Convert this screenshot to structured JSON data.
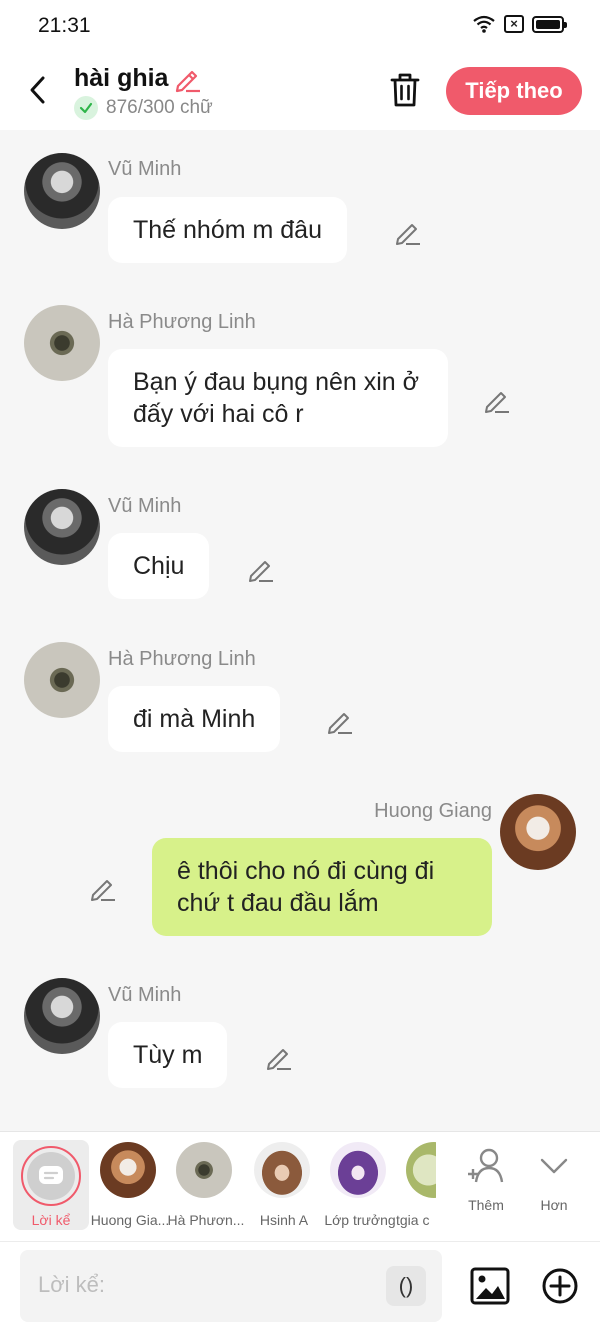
{
  "status_bar": {
    "time": "21:31"
  },
  "header": {
    "title": "hài ghia",
    "word_count": "876/300 chữ",
    "next_button": "Tiếp theo"
  },
  "messages": [
    {
      "sender": "Vũ Minh",
      "text": "Thế nhóm m đâu",
      "side": "left"
    },
    {
      "sender": "Hà Phương Linh",
      "text": "Bạn ý đau bụng nên xin ở đấy với hai cô r",
      "side": "left"
    },
    {
      "sender": "Vũ Minh",
      "text": "Chịu",
      "side": "left"
    },
    {
      "sender": "Hà Phương Linh",
      "text": "đi mà Minh",
      "side": "left"
    },
    {
      "sender": "Huong Giang",
      "text": "ê thôi cho nó đi cùng đi chứ t đau đầu lắm",
      "side": "right"
    },
    {
      "sender": "Vũ Minh",
      "text": "Tùy m",
      "side": "left"
    }
  ],
  "tray": {
    "narrator_label": "Lời kể",
    "characters": [
      "Huong Gia...",
      "Hà Phươn...",
      "Hsinh A",
      "Lớp trưởng",
      "tgia c"
    ],
    "add_label": "Thêm",
    "more_label": "Hơn"
  },
  "input": {
    "placeholder": "Lời kể:",
    "paren_label": "()"
  },
  "colors": {
    "accent": "#f05a6b",
    "own_bubble": "#d7f18a",
    "check": "#2fb54a"
  }
}
